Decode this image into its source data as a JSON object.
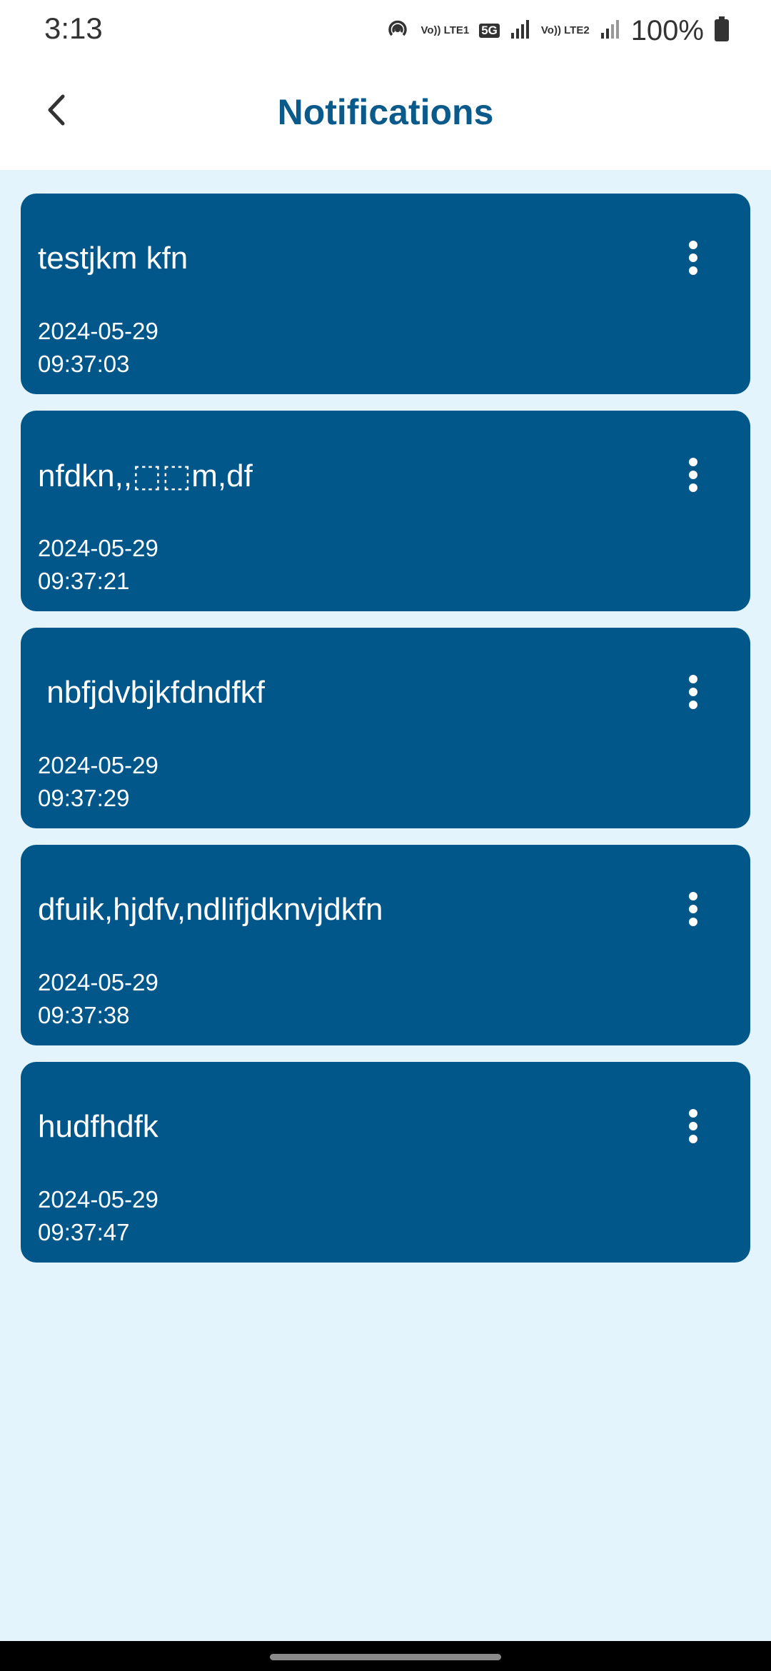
{
  "status_bar": {
    "time": "3:13",
    "network": [
      "Vo)) LTE1",
      "5G",
      "Vo)) LTE2"
    ],
    "battery": "100%",
    "icons": [
      "hotspot-icon",
      "signal-icon",
      "battery-icon"
    ]
  },
  "header": {
    "title": "Notifications",
    "back_icon": "chevron-left-icon"
  },
  "notifications": [
    {
      "title": "testjkm kfn",
      "date": "2024-05-29",
      "time": "09:37:03"
    },
    {
      "title": "nfdkn,,⬚⬚m,df",
      "date": "2024-05-29",
      "time": "09:37:21"
    },
    {
      "title": " nbfjdvbjkfdndfkf",
      "date": "2024-05-29",
      "time": "09:37:29"
    },
    {
      "title": "dfuik,hjdfv,ndlifjdknvjdkfn",
      "date": "2024-05-29",
      "time": "09:37:38"
    },
    {
      "title": "hudfhdfk",
      "date": "2024-05-29",
      "time": "09:37:47"
    }
  ],
  "colors": {
    "accent": "#0a5a8c",
    "card": "#02578a",
    "background": "#e3f4fc"
  }
}
